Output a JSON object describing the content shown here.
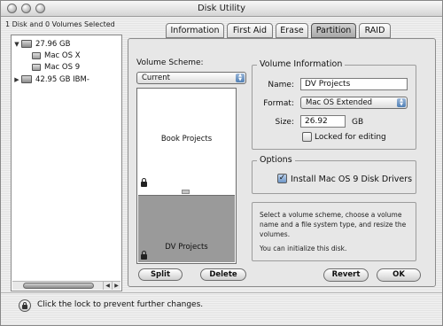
{
  "window": {
    "title": "Disk Utility"
  },
  "sidebar": {
    "selection_info": "1 Disk and 0 Volumes Selected",
    "items": [
      {
        "label": "27.96 GB",
        "kind": "disk",
        "expanded": true
      },
      {
        "label": "Mac OS X",
        "kind": "volume"
      },
      {
        "label": "Mac OS 9",
        "kind": "volume"
      },
      {
        "label": "42.95 GB IBM-",
        "kind": "disk",
        "expanded": false
      }
    ]
  },
  "tabs": [
    {
      "label": "Information",
      "active": false
    },
    {
      "label": "First Aid",
      "active": false
    },
    {
      "label": "Erase",
      "active": false
    },
    {
      "label": "Partition",
      "active": true
    },
    {
      "label": "RAID",
      "active": false
    }
  ],
  "partition": {
    "scheme_label": "Volume Scheme:",
    "scheme_value": "Current",
    "partitions": [
      {
        "label": "Book Projects",
        "locked": true,
        "selected": false
      },
      {
        "label": "DV Projects",
        "locked": true,
        "selected": true
      }
    ],
    "split_label": "Split",
    "delete_label": "Delete"
  },
  "volume_info": {
    "title": "Volume Information",
    "name_label": "Name:",
    "name_value": "DV Projects",
    "format_label": "Format:",
    "format_value": "Mac OS Extended",
    "size_label": "Size:",
    "size_value": "26.92",
    "size_unit": "GB",
    "locked_label": "Locked for editing",
    "locked_checked": false
  },
  "options": {
    "title": "Options",
    "install_label": "Install Mac OS 9 Disk Drivers",
    "install_checked": true
  },
  "help": {
    "line1": "Select a volume scheme, choose a volume name and a file system type, and resize the volumes.",
    "line2": "You can initialize this disk."
  },
  "buttons": {
    "revert": "Revert",
    "ok": "OK"
  },
  "footer": {
    "lock_text": "Click the lock to prevent further changes."
  },
  "colors": {
    "selected_partition": "#9a9a9a",
    "accent": "#5b86c0"
  },
  "icons": [
    "close-icon",
    "minimize-icon",
    "zoom-icon",
    "disk-icon",
    "volume-icon",
    "lock-icon",
    "popup-arrows-icon",
    "checkmark-icon"
  ]
}
